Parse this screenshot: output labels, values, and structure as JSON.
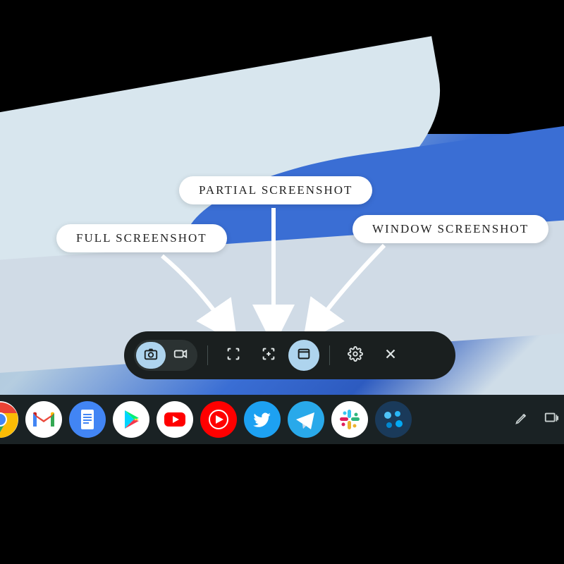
{
  "annotations": {
    "full": "FULL SCREENSHOT",
    "partial": "PARTIAL SCREENSHOT",
    "window": "WINDOW SCREENSHOT"
  },
  "toolbar": {
    "mode": {
      "screenshot_selected": true,
      "video_selected": false
    },
    "capture": {
      "full_selected": false,
      "partial_selected": false,
      "window_selected": true
    }
  },
  "shelf": {
    "apps": [
      "chrome",
      "gmail",
      "docs",
      "play-store",
      "youtube",
      "youtube-music",
      "twitter",
      "telegram",
      "slack",
      "colorful-app"
    ]
  }
}
